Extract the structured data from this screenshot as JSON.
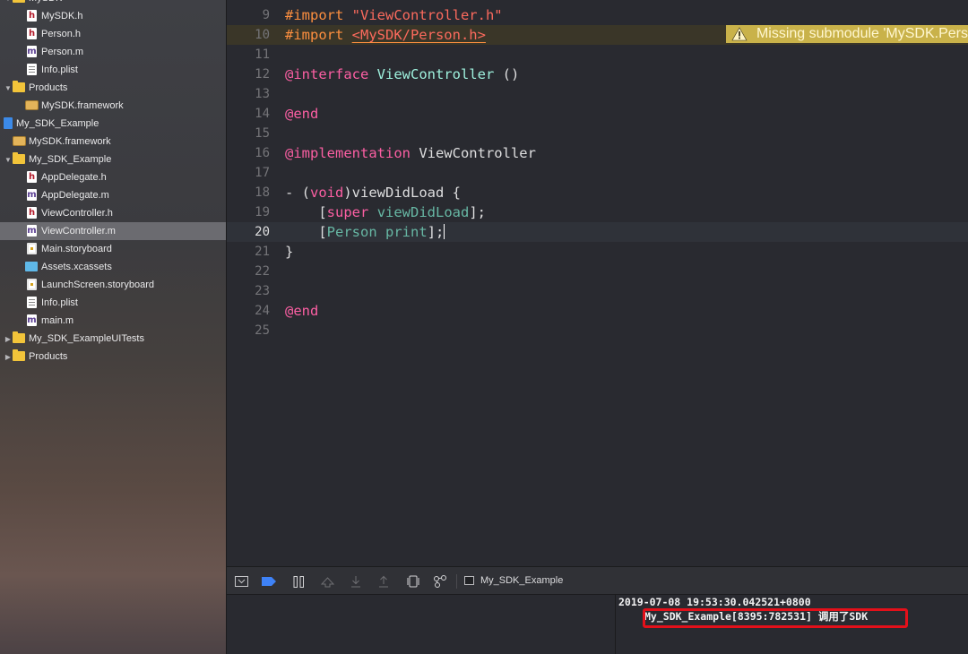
{
  "navigator": {
    "items": [
      {
        "label": "MySDK",
        "icon": "folder-icon",
        "disclosure": "expanded"
      },
      {
        "label": "MySDK.h",
        "icon": "header-file-icon"
      },
      {
        "label": "Person.h",
        "icon": "header-file-icon"
      },
      {
        "label": "Person.m",
        "icon": "objc-file-icon"
      },
      {
        "label": "Info.plist",
        "icon": "plist-file-icon"
      },
      {
        "label": "Products",
        "icon": "folder-icon",
        "disclosure": "expanded"
      },
      {
        "label": "MySDK.framework",
        "icon": "framework-icon"
      },
      {
        "label": "My_SDK_Example",
        "icon": "project-icon"
      },
      {
        "label": "MySDK.framework",
        "icon": "framework-icon"
      },
      {
        "label": "My_SDK_Example",
        "icon": "folder-icon",
        "disclosure": "expanded"
      },
      {
        "label": "AppDelegate.h",
        "icon": "header-file-icon"
      },
      {
        "label": "AppDelegate.m",
        "icon": "objc-file-icon"
      },
      {
        "label": "ViewController.h",
        "icon": "header-file-icon"
      },
      {
        "label": "ViewController.m",
        "icon": "objc-file-icon",
        "selected": true
      },
      {
        "label": "Main.storyboard",
        "icon": "storyboard-icon"
      },
      {
        "label": "Assets.xcassets",
        "icon": "assets-folder-icon"
      },
      {
        "label": "LaunchScreen.storyboard",
        "icon": "storyboard-icon"
      },
      {
        "label": "Info.plist",
        "icon": "plist-file-icon"
      },
      {
        "label": "main.m",
        "icon": "objc-file-icon"
      },
      {
        "label": "My_SDK_ExampleUITests",
        "icon": "folder-icon",
        "disclosure": "collapsed"
      },
      {
        "label": "Products",
        "icon": "folder-icon",
        "disclosure": "collapsed"
      }
    ]
  },
  "editor": {
    "lines": [
      {
        "n": "9",
        "tokens": [
          [
            "pre",
            "#import "
          ],
          [
            "str",
            "\"ViewController.h\""
          ]
        ]
      },
      {
        "n": "10",
        "tokens": [
          [
            "pre",
            "#import "
          ],
          [
            "str",
            "<MySDK/Person.h>"
          ]
        ],
        "warning": true
      },
      {
        "n": "11",
        "tokens": []
      },
      {
        "n": "12",
        "tokens": [
          [
            "kw",
            "@interface "
          ],
          [
            "cls",
            "ViewController"
          ],
          [
            "plain",
            " ()"
          ]
        ]
      },
      {
        "n": "13",
        "tokens": []
      },
      {
        "n": "14",
        "tokens": [
          [
            "kw",
            "@end"
          ]
        ]
      },
      {
        "n": "15",
        "tokens": []
      },
      {
        "n": "16",
        "tokens": [
          [
            "kw",
            "@implementation "
          ],
          [
            "plain",
            "ViewController"
          ]
        ]
      },
      {
        "n": "17",
        "tokens": []
      },
      {
        "n": "18",
        "tokens": [
          [
            "plain",
            "- ("
          ],
          [
            "kw",
            "void"
          ],
          [
            "plain",
            ")viewDidLoad {"
          ]
        ]
      },
      {
        "n": "19",
        "tokens": [
          [
            "plain",
            "    ["
          ],
          [
            "kw",
            "super"
          ],
          [
            "plain",
            " "
          ],
          [
            "meth",
            "viewDidLoad"
          ],
          [
            "plain",
            "];"
          ]
        ]
      },
      {
        "n": "20",
        "tokens": [
          [
            "plain",
            "    ["
          ],
          [
            "meth",
            "Person"
          ],
          [
            "plain",
            " "
          ],
          [
            "meth",
            "print"
          ],
          [
            "plain",
            "];"
          ]
        ],
        "current": true
      },
      {
        "n": "21",
        "tokens": [
          [
            "plain",
            "}"
          ]
        ]
      },
      {
        "n": "22",
        "tokens": []
      },
      {
        "n": "23",
        "tokens": []
      },
      {
        "n": "24",
        "tokens": [
          [
            "kw",
            "@end"
          ]
        ]
      },
      {
        "n": "25",
        "tokens": []
      }
    ],
    "warning_text": "Missing submodule 'MySDK.Pers"
  },
  "debug_bar": {
    "scheme_label": "My_SDK_Example"
  },
  "console": {
    "line1": "2019-07-08 19:53:30.042521+0800",
    "line2": "My_SDK_Example[8395:782531] 调用了SDK"
  },
  "colors": {
    "keyword": "#fc5fa3",
    "preprocessor": "#fd8f3f",
    "string": "#fc6a5d",
    "class": "#9ef1dd",
    "method": "#67b7a4",
    "warning": "#c9b24a",
    "highlight": "#e3101a"
  }
}
